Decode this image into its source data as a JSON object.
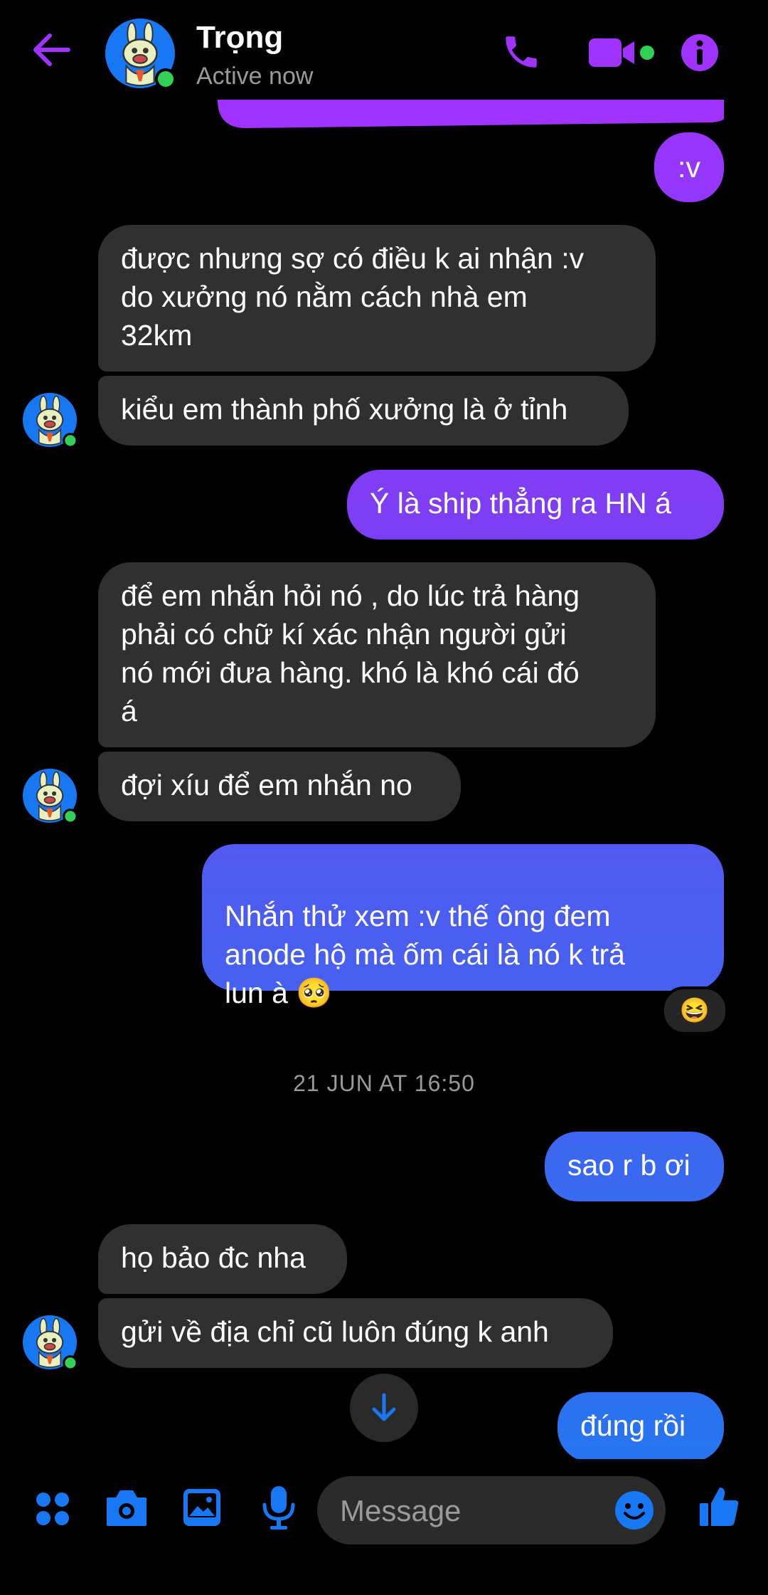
{
  "colors": {
    "accent": "#A033FF",
    "composer_blue": "#1877F2",
    "incoming_bubble": "#303030",
    "outgoing_gradient": [
      "#A033FF",
      "#7B3FF2",
      "#4E5CF0",
      "#1F7AF0"
    ],
    "online": "#31D158"
  },
  "header": {
    "contact_name": "Trọng",
    "status": "Active now",
    "icons": [
      "arrow-left-icon",
      "phone-icon",
      "video-camera-icon",
      "info-icon"
    ]
  },
  "messages": [
    {
      "from": "me",
      "text": ":v"
    },
    {
      "from": "them",
      "text": "được nhưng sợ có điều k ai nhận :v\ndo xưởng nó nằm cách nhà em\n32km"
    },
    {
      "from": "them",
      "text": "kiểu em thành phố xưởng là ở tỉnh"
    },
    {
      "from": "me",
      "text": "Ý là ship thẳng ra HN á"
    },
    {
      "from": "them",
      "text": "để em nhắn hỏi nó , do lúc trả hàng\nphải có chữ kí xác nhận người gửi\nnó mới đưa hàng. khó là khó cái đó\ná"
    },
    {
      "from": "them",
      "text": "đợi xíu để em nhắn no"
    },
    {
      "from": "me",
      "text": "Nhắn thử xem :v thế ông đem\nanode hộ mà ốm cái là nó k trả\nlun à",
      "emoji": "🥺",
      "reaction": "😆"
    },
    {
      "from": "me",
      "text": "sao r b ơi"
    },
    {
      "from": "them",
      "text": "họ bảo đc nha"
    },
    {
      "from": "them",
      "text": "gửi về địa chỉ cũ luôn đúng k anh"
    },
    {
      "from": "me",
      "text": "đúng rồi"
    }
  ],
  "timestamp": "21 JUN AT 16:50",
  "composer": {
    "placeholder": "Message",
    "icons": [
      "apps-icon",
      "camera-icon",
      "gallery-icon",
      "microphone-icon",
      "emoji-icon",
      "thumbs-up-icon"
    ]
  }
}
